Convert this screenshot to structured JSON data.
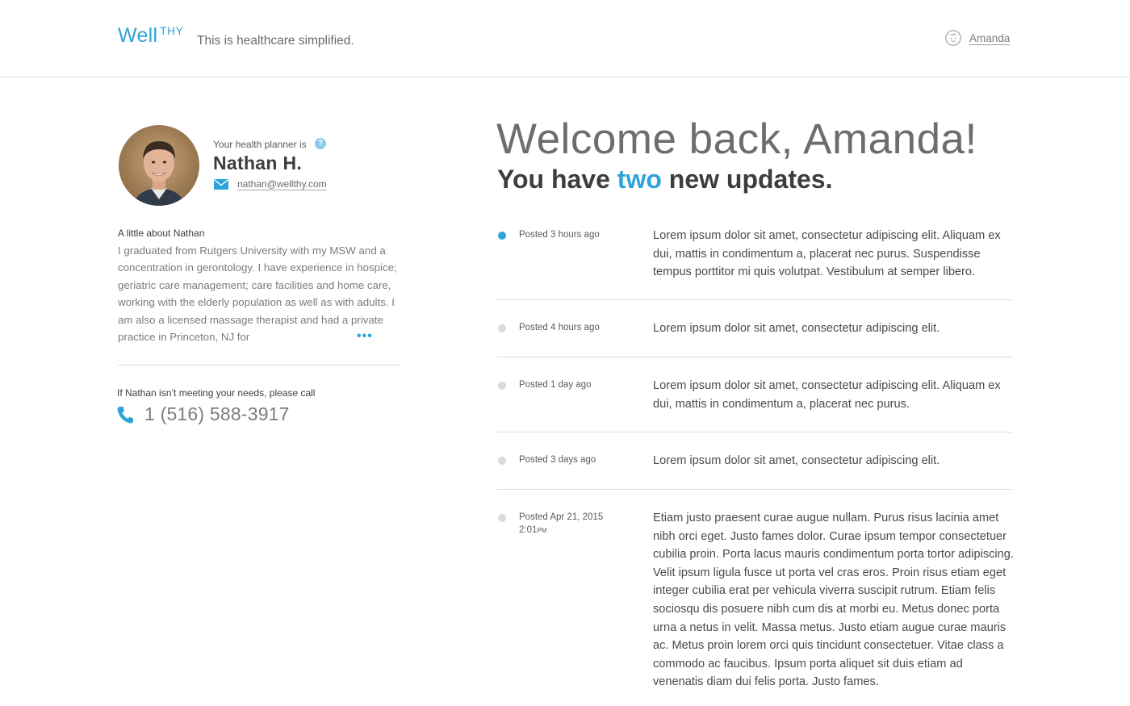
{
  "header": {
    "logo_main": "Well",
    "logo_sup": "THY",
    "tagline": "This is healthcare simplified.",
    "user_name": "Amanda",
    "user_icon": "user-avatar-icon"
  },
  "planner": {
    "label": "Your health planner is",
    "name": "Nathan H.",
    "email": "nathan@wellthy.com",
    "help_icon_text": "?",
    "about_heading": "A little about Nathan",
    "about_text": "I graduated from Rutgers University with my MSW and a concentration in gerontology. I have experience in hospice; geriatric care management; care facilities and home care, working with the elderly population as well as with adults. I am also a licensed massage therapist and had a private practice in Princeton, NJ for",
    "more_text": "•••",
    "call_label": "If Nathan isn’t meeting your needs, please call",
    "phone": "1 (516) 588-3917"
  },
  "main": {
    "welcome": "Welcome back, Amanda!",
    "updates_prefix": "You have ",
    "updates_count": "two",
    "updates_suffix": " new updates.",
    "updates": [
      {
        "posted": "Posted 3 hours ago",
        "text": "Lorem ipsum dolor sit amet, consectetur adipiscing elit. Aliquam ex dui, mattis in condimentum a, placerat nec purus. Suspendisse tempus porttitor mi quis volutpat. Vestibulum at semper libero.",
        "unread": true
      },
      {
        "posted": "Posted 4 hours ago",
        "text": "Lorem ipsum dolor sit amet, consectetur adipiscing elit.",
        "unread": false
      },
      {
        "posted": "Posted 1 day ago",
        "text": "Lorem ipsum dolor sit amet, consectetur adipiscing elit. Aliquam ex dui, mattis in condimentum a, placerat nec purus.",
        "unread": false
      },
      {
        "posted": "Posted 3 days ago",
        "text": "Lorem ipsum dolor sit amet, consectetur adipiscing elit.",
        "unread": false
      },
      {
        "posted": "Posted Apr 21, 2015",
        "posted_time": "2:01",
        "posted_ampm": "PM",
        "text": "Etiam justo praesent curae augue nullam. Purus risus lacinia amet nibh orci eget. Justo fames dolor. Curae ipsum tempor consectetuer cubilia proin. Porta lacus mauris condimentum porta tortor adipiscing. Velit ipsum ligula fusce ut porta vel cras eros. Proin risus etiam eget integer cubilia erat per vehicula viverra suscipit rutrum. Etiam felis sociosqu dis posuere nibh cum dis at morbi eu. Metus donec porta urna a netus in velit. Massa metus. Justo etiam augue curae mauris ac. Metus proin lorem orci quis tincidunt consectetuer. Vitae class a commodo ac faucibus. Ipsum porta aliquet sit duis etiam ad venenatis diam dui felis porta. Justo fames.",
        "unread": false
      }
    ]
  },
  "colors": {
    "accent": "#2ea3d9",
    "divider": "#dcdcdc",
    "dot_read": "#dadada"
  }
}
